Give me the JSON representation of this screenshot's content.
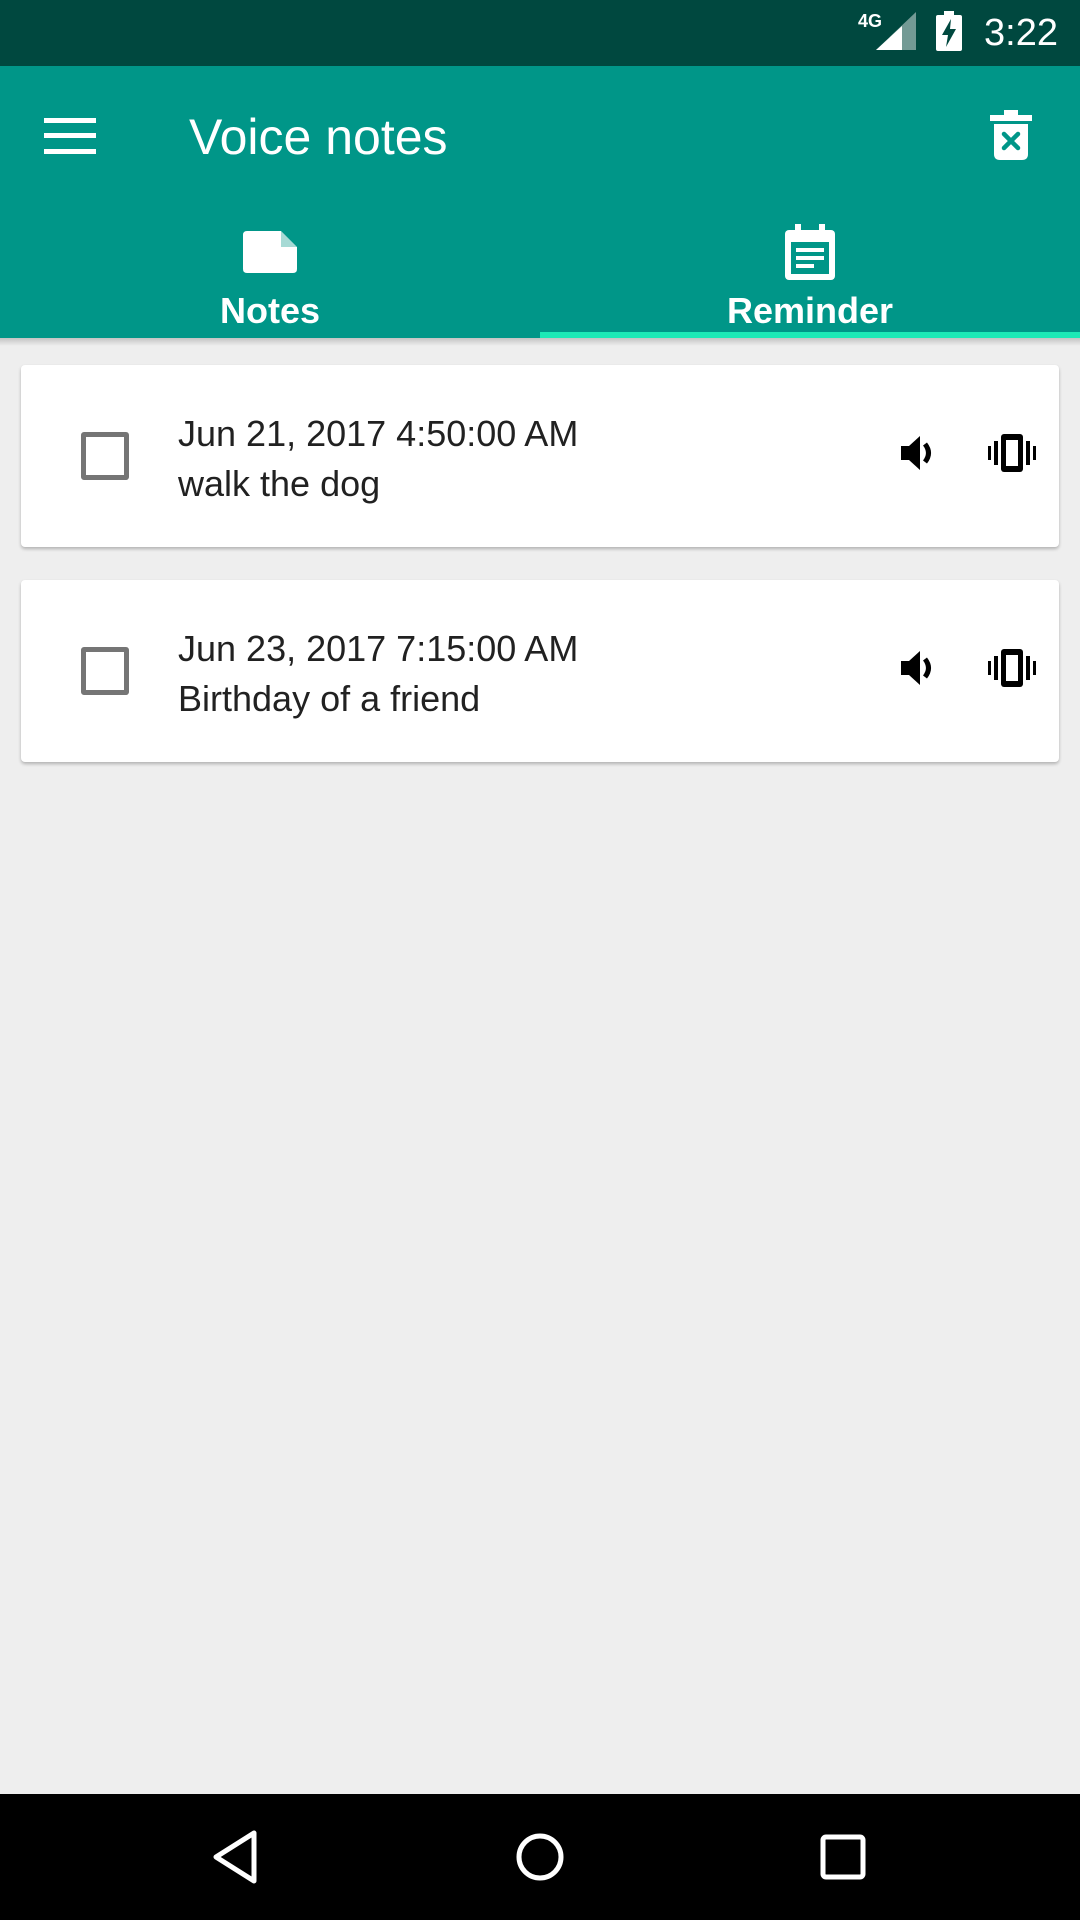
{
  "status_bar": {
    "network": "4G",
    "time": "3:22"
  },
  "toolbar": {
    "title": "Voice notes",
    "menu_icon": "menu-icon",
    "delete_icon": "delete-icon"
  },
  "tabs": [
    {
      "label": "Notes",
      "icon": "note-icon",
      "selected": false
    },
    {
      "label": "Reminder",
      "icon": "calendar-icon",
      "selected": true
    }
  ],
  "reminders": [
    {
      "date": "Jun 21, 2017 4:50:00 AM",
      "text": "walk the dog",
      "checked": false
    },
    {
      "date": "Jun 23, 2017 7:15:00 AM",
      "text": "Birthday of a friend",
      "checked": false
    }
  ],
  "colors": {
    "primary": "#009688",
    "primary_dark": "#00483f",
    "accent": "#1de9b6",
    "background": "#eeeeee"
  }
}
